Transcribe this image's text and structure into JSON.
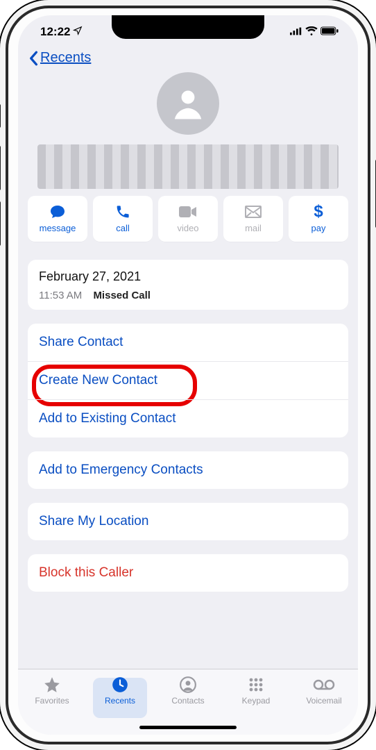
{
  "status": {
    "time": "12:22"
  },
  "nav": {
    "back_label": "Recents"
  },
  "quick_actions": {
    "message": "message",
    "call": "call",
    "video": "video",
    "mail": "mail",
    "pay": "pay"
  },
  "history": {
    "date": "February 27, 2021",
    "time": "11:53 AM",
    "status": "Missed Call"
  },
  "contact_actions": {
    "share_contact": "Share Contact",
    "create_new_contact": "Create New Contact",
    "add_to_existing": "Add to Existing Contact",
    "add_to_emergency": "Add to Emergency Contacts",
    "share_location": "Share My Location",
    "block_caller": "Block this Caller"
  },
  "tabs": {
    "favorites": "Favorites",
    "recents": "Recents",
    "contacts": "Contacts",
    "keypad": "Keypad",
    "voicemail": "Voicemail"
  }
}
